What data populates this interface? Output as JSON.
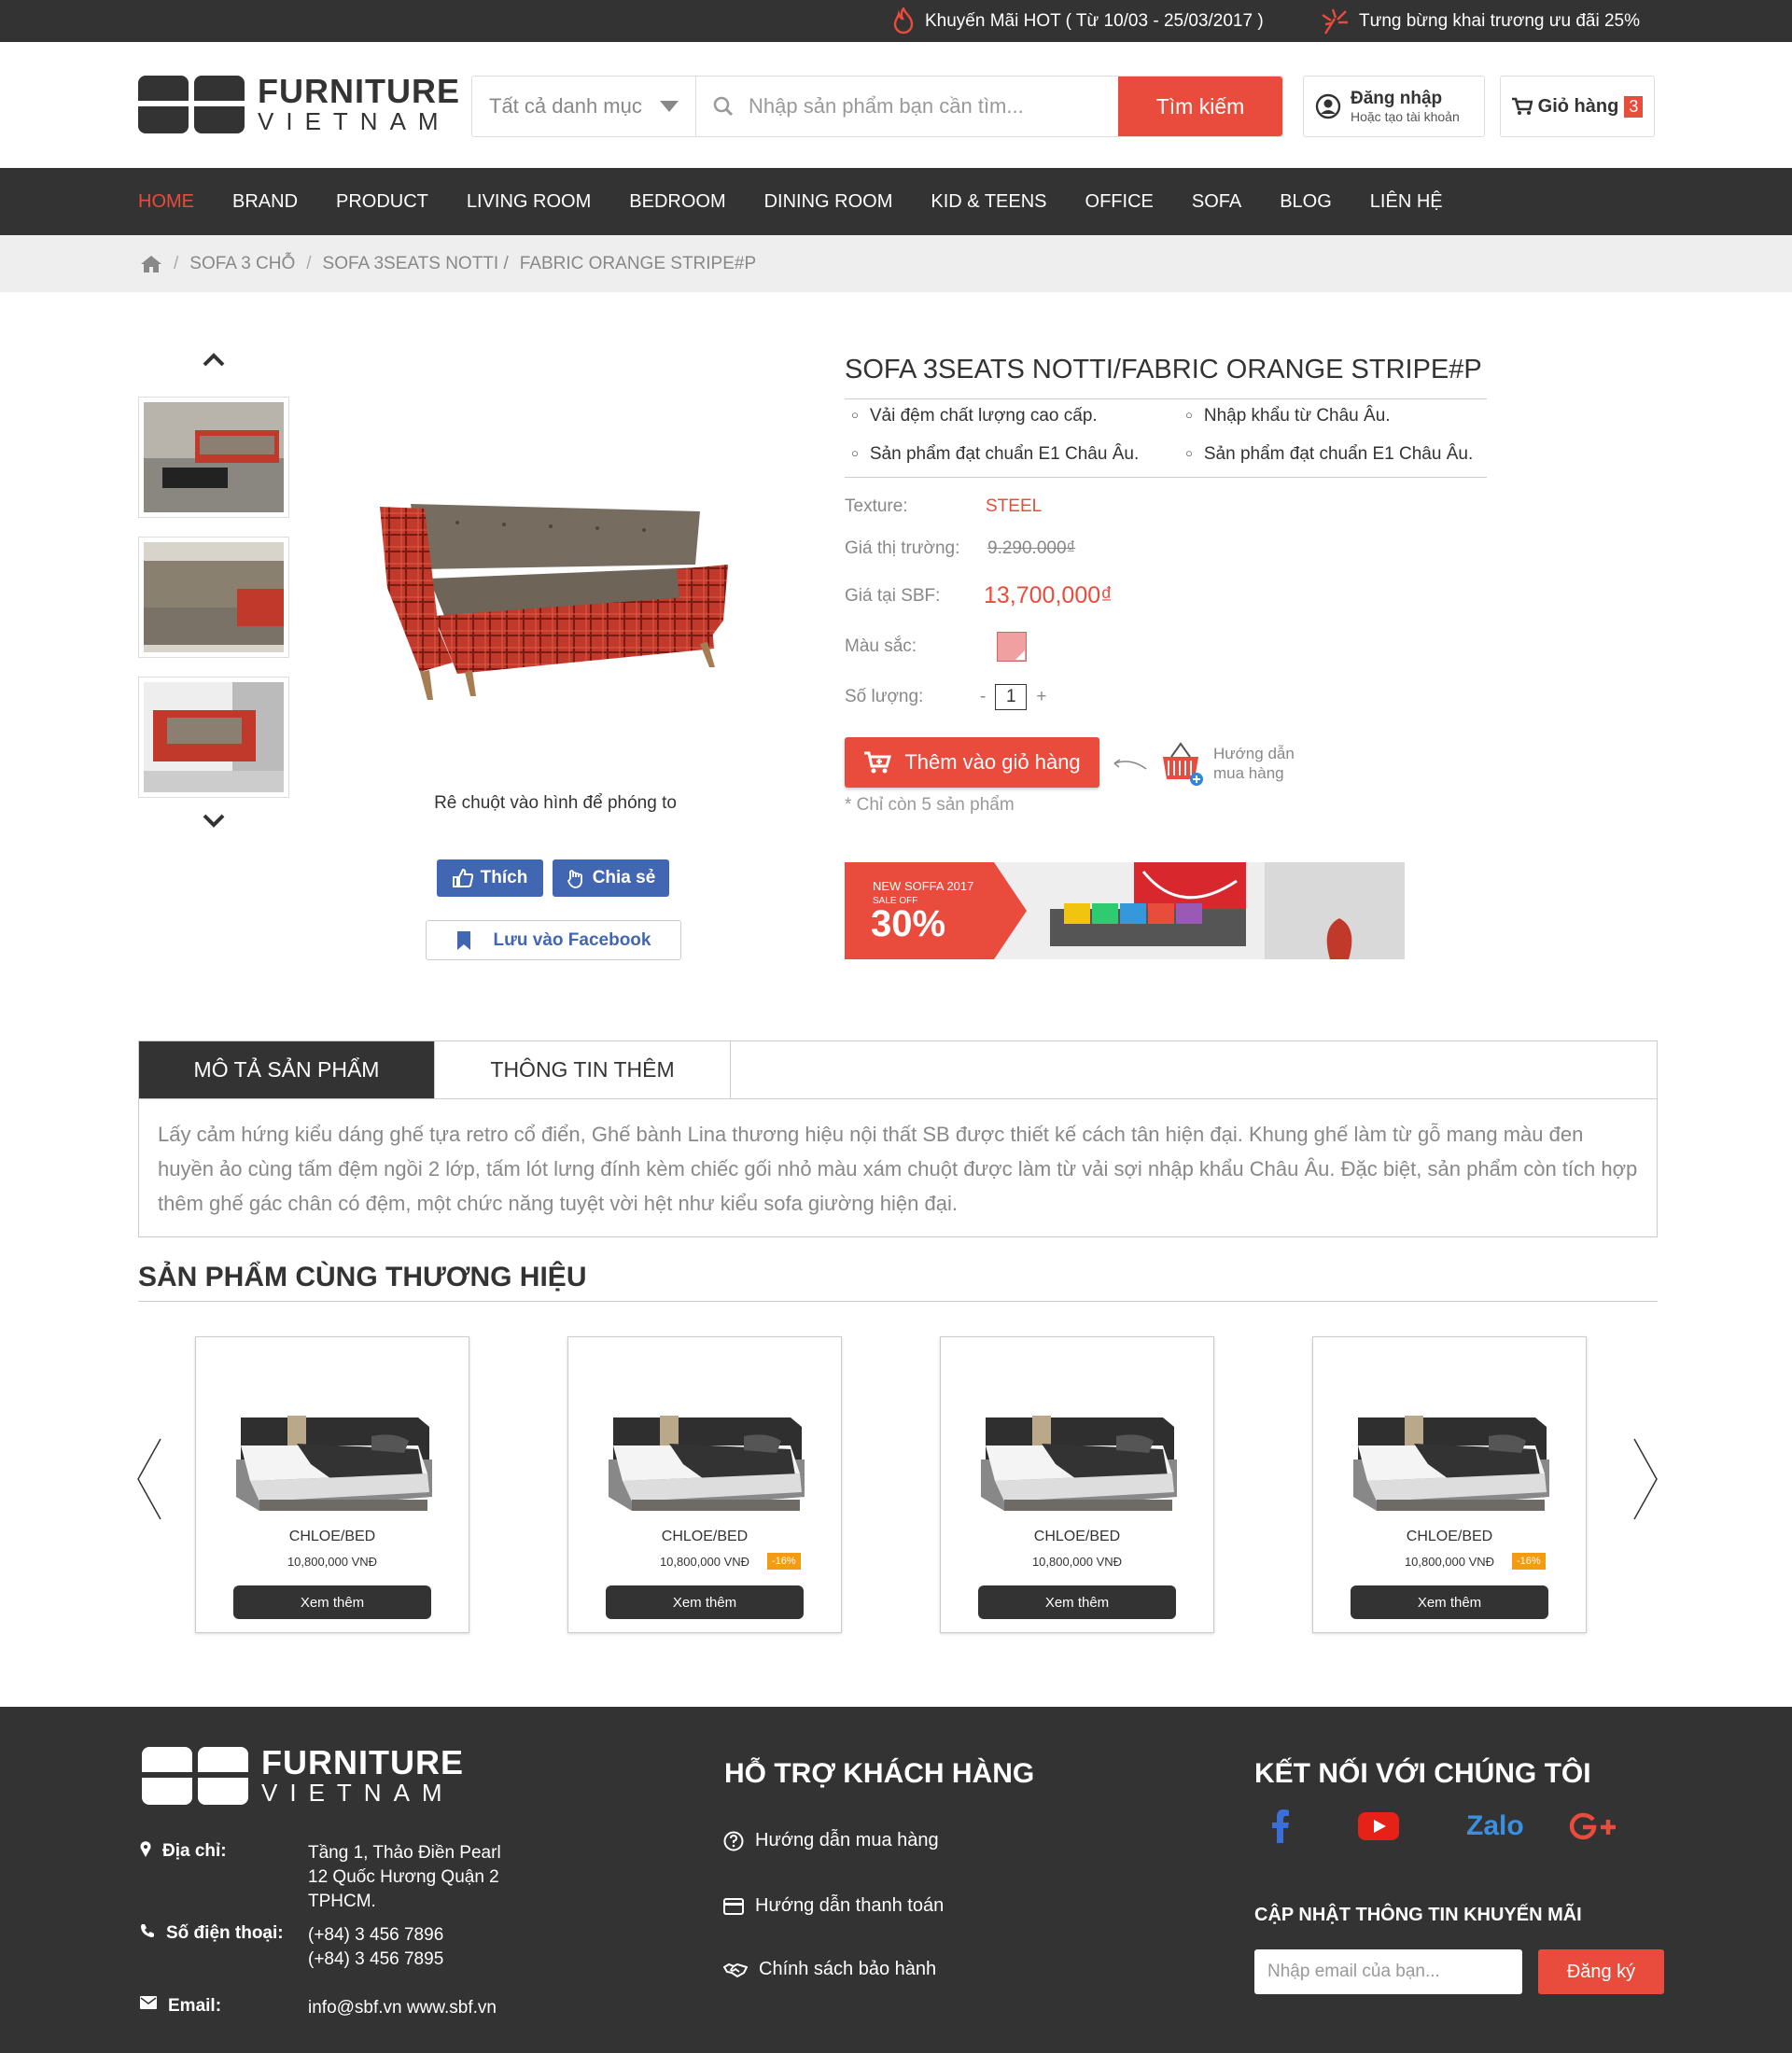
{
  "topbar": {
    "promo1": "Khuyến Mãi HOT ( Từ 10/03 - 25/03/2017 )",
    "promo2": "Tưng bừng khai trương ưu đãi 25%"
  },
  "logo": {
    "line1": "FURNITURE",
    "line2": "VIETNAM"
  },
  "search": {
    "category": "Tất cả danh mục",
    "placeholder": "Nhập sản phẩm bạn cần tìm...",
    "button": "Tìm kiếm"
  },
  "account": {
    "title": "Đăng nhập",
    "subtitle": "Hoặc tạo tài khoản"
  },
  "cart": {
    "label": "Giỏ hàng",
    "count": "3"
  },
  "nav": [
    "HOME",
    "BRAND",
    "PRODUCT",
    "LIVING ROOM",
    "BEDROOM",
    "DINING ROOM",
    "KID & TEENS",
    "OFFICE",
    "SOFA",
    "BLOG",
    "LIÊN HỆ"
  ],
  "breadcrumb": [
    "SOFA 3 CHỖ",
    "SOFA 3SEATS NOTTI /",
    "FABRIC ORANGE STRIPE#P"
  ],
  "gallery": {
    "zoom_hint": "Rê chuột vào hình để phóng to"
  },
  "social_buttons": {
    "like": "Thích",
    "share": "Chia sẻ",
    "save": "Lưu vào Facebook"
  },
  "product": {
    "title": "SOFA 3SEATS NOTTI/FABRIC ORANGE STRIPE#P",
    "features": [
      "Vải đệm chất lượng cao cấp.",
      "Nhập khẩu từ Châu Âu.",
      "Sản phẩm đạt chuẩn E1 Châu Âu.",
      "Sản phẩm đạt chuẩn E1 Châu Âu."
    ],
    "texture_label": "Texture:",
    "texture": "STEEL",
    "market_price_label": "Giá thị trường:",
    "market_price": "9.290.000₫",
    "price_label": "Giá tại SBF:",
    "price": "13,700,000₫",
    "color_label": "Màu sắc:",
    "color_value": "#f0a0a0",
    "qty_label": "Số lượng:",
    "qty_minus": "-",
    "qty": "1",
    "qty_plus": "+",
    "add_to_cart": "Thêm vào giỏ hàng",
    "guide_line1": "Hướng dẫn",
    "guide_line2": "mua hàng",
    "stock_note": "* Chỉ còn 5 sản phẩm"
  },
  "banner": {
    "line1": "NEW SOFFA 2017",
    "line2": "SALE OFF",
    "percent": "30%"
  },
  "tabs": {
    "tab1": "MÔ TẢ SẢN PHẨM",
    "tab2": "THÔNG TIN THÊM",
    "description": "Lấy cảm hứng kiểu dáng ghế tựa retro cổ điển, Ghế bành Lina thương hiệu nội thất SB được thiết kế cách tân hiện đại. Khung ghế làm từ gỗ mang màu đen huyền ảo cùng tấm đệm ngồi 2 lớp, tấm lót lưng đính kèm chiếc gối nhỏ màu xám chuột được làm từ vải sợi nhập khẩu Châu Âu. Đặc biệt, sản phẩm còn tích hợp thêm ghế gác chân có đệm, một chức năng tuyệt vời hệt như kiểu sofa giường hiện đại."
  },
  "related": {
    "title": "SẢN PHẨM CÙNG THƯƠNG HIỆU",
    "items": [
      {
        "name": "CHLOE/BED",
        "price": "10,800,000 VNĐ",
        "discount": "",
        "button": "Xem thêm"
      },
      {
        "name": "CHLOE/BED",
        "price": "10,800,000 VNĐ",
        "discount": "-16%",
        "button": "Xem thêm"
      },
      {
        "name": "CHLOE/BED",
        "price": "10,800,000 VNĐ",
        "discount": "",
        "button": "Xem thêm"
      },
      {
        "name": "CHLOE/BED",
        "price": "10,800,000 VNĐ",
        "discount": "-16%",
        "button": "Xem thêm"
      }
    ]
  },
  "footer": {
    "address_label": "Địa chỉ:",
    "address": [
      "Tầng 1, Thảo Điền Pearl",
      "12 Quốc Hương Quận 2",
      "TPHCM."
    ],
    "phone_label": "Số điện thoại:",
    "phones": [
      "(+84) 3 456 7896",
      "(+84) 3 456 7895"
    ],
    "email_label": "Email:",
    "email": "info@sbf.vn www.sbf.vn",
    "support_title": "HỖ TRỢ KHÁCH HÀNG",
    "support_links": [
      "Hướng dẫn mua hàng",
      "Hướng dẫn thanh toán",
      "Chính sách bảo hành"
    ],
    "connect_title": "KẾT NỐI VỚI CHÚNG TÔI",
    "zalo": "Zalo",
    "newsletter_title": "CẬP NHẬT THÔNG TIN KHUYẾN MÃI",
    "newsletter_placeholder": "Nhập email của bạn...",
    "newsletter_button": "Đăng ký"
  },
  "colors": {
    "accent": "#e94b3c",
    "dark": "#333333",
    "facebook": "#4267b2"
  }
}
